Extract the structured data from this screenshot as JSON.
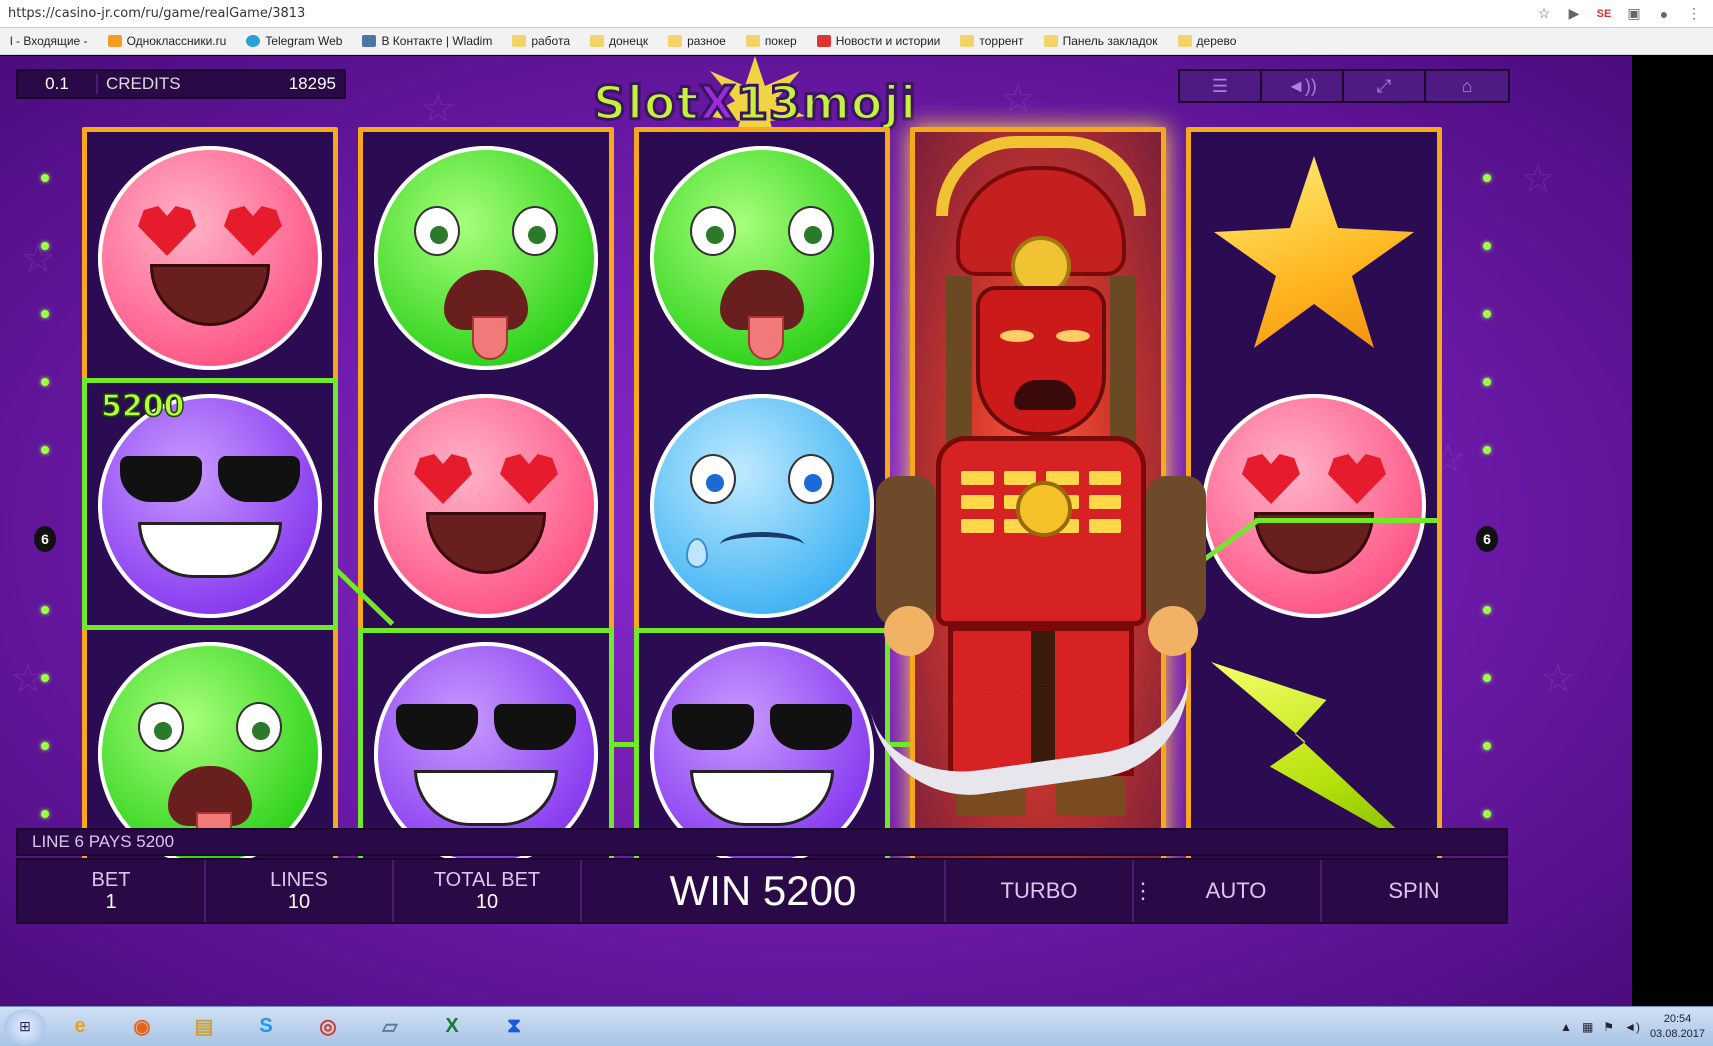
{
  "browser": {
    "url": "https://casino-jr.com/ru/game/realGame/3813",
    "bookmarks": [
      {
        "label": "l - Входящие -",
        "icon": "mail-icon"
      },
      {
        "label": "Одноклассники.ru",
        "icon": "ok-icon"
      },
      {
        "label": "Telegram Web",
        "icon": "telegram-icon"
      },
      {
        "label": "В Контакте | Wladim",
        "icon": "vk-icon"
      },
      {
        "label": "работа",
        "icon": "folder-icon"
      },
      {
        "label": "донецк",
        "icon": "folder-icon"
      },
      {
        "label": "разное",
        "icon": "folder-icon"
      },
      {
        "label": "покер",
        "icon": "folder-icon"
      },
      {
        "label": "Новости и истории",
        "icon": "percent-icon"
      },
      {
        "label": "торрент",
        "icon": "folder-icon"
      },
      {
        "label": "Панель закладок",
        "icon": "folder-icon"
      },
      {
        "label": "дерево",
        "icon": "folder-icon"
      }
    ]
  },
  "game": {
    "logo": {
      "part1": "Slot",
      "part2": "X",
      "part3": "13",
      "part4": "moji"
    },
    "denomination": "0.1",
    "credits_label": "CREDITS",
    "credits_value": "18295",
    "top_buttons": [
      "menu-icon",
      "sound-icon",
      "fullscreen-icon",
      "home-icon"
    ],
    "top_button_glyphs": [
      "☰",
      "◄))",
      "⤢",
      "⌂"
    ],
    "reels": [
      [
        "love",
        "cool",
        "sick"
      ],
      [
        "sick",
        "love",
        "cool"
      ],
      [
        "sick",
        "sad",
        "cool"
      ],
      [
        "samurai",
        "samurai",
        "samurai"
      ],
      [
        "star",
        "love",
        "bolt"
      ]
    ],
    "win_label_amount": "5200",
    "payline_number": "6",
    "status": "LINE 6 PAYS 5200",
    "controls": {
      "bet_label": "BET",
      "bet_value": "1",
      "lines_label": "LINES",
      "lines_value": "10",
      "total_bet_label": "TOTAL BET",
      "total_bet_value": "10",
      "win_text": "WIN 5200",
      "turbo": "TURBO",
      "auto": "AUTO",
      "spin": "SPIN"
    }
  },
  "taskbar": {
    "apps": [
      "ie-icon",
      "firefox-icon",
      "explorer-icon",
      "skype-icon",
      "chrome-icon",
      "notepad-icon",
      "excel-icon",
      "hourglass-icon"
    ],
    "time": "20:54",
    "date": "03.08.2017"
  }
}
